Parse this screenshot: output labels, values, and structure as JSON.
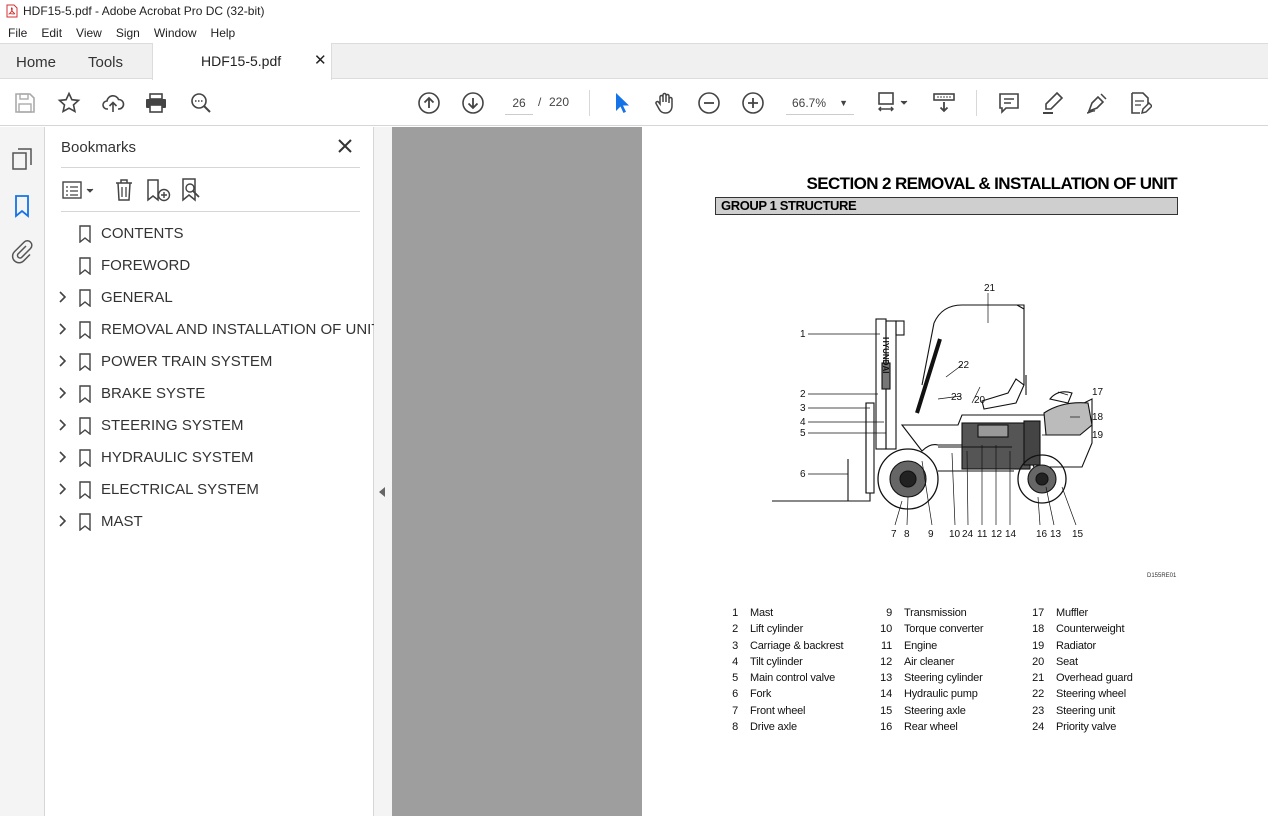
{
  "window": {
    "title": "HDF15-5.pdf - Adobe Acrobat Pro DC (32-bit)"
  },
  "menu": [
    "File",
    "Edit",
    "View",
    "Sign",
    "Window",
    "Help"
  ],
  "tabs": {
    "home": "Home",
    "tools": "Tools",
    "document": "HDF15-5.pdf"
  },
  "toolbar": {
    "page_current": "26",
    "page_separator": "/",
    "page_total": "220",
    "zoom": "66.7%"
  },
  "bookmarks_panel": {
    "title": "Bookmarks",
    "items": [
      {
        "label": "CONTENTS",
        "expandable": false
      },
      {
        "label": "FOREWORD",
        "expandable": false
      },
      {
        "label": "GENERAL",
        "expandable": true
      },
      {
        "label": "REMOVAL AND INSTALLATION OF UNIT",
        "expandable": true
      },
      {
        "label": "POWER TRAIN SYSTEM",
        "expandable": true
      },
      {
        "label": "BRAKE SYSTE",
        "expandable": true
      },
      {
        "label": "STEERING SYSTEM",
        "expandable": true
      },
      {
        "label": "HYDRAULIC SYSTEM",
        "expandable": true
      },
      {
        "label": "ELECTRICAL SYSTEM",
        "expandable": true
      },
      {
        "label": "MAST",
        "expandable": true
      }
    ]
  },
  "document": {
    "section_title": "SECTION 2 REMOVAL & INSTALLATION OF UNIT",
    "group_title": "GROUP 1 STRUCTURE",
    "diagram_code": "D155RE01",
    "diagram_callouts": [
      "1",
      "2",
      "3",
      "4",
      "5",
      "6",
      "7",
      "8",
      "9",
      "10",
      "24",
      "11",
      "12",
      "14",
      "16",
      "13",
      "15",
      "17",
      "18",
      "19",
      "20",
      "21",
      "22",
      "23"
    ],
    "legend": [
      [
        {
          "n": "1",
          "t": "Mast"
        },
        {
          "n": "2",
          "t": "Lift cylinder"
        },
        {
          "n": "3",
          "t": "Carriage & backrest"
        },
        {
          "n": "4",
          "t": "Tilt cylinder"
        },
        {
          "n": "5",
          "t": "Main control valve"
        },
        {
          "n": "6",
          "t": "Fork"
        },
        {
          "n": "7",
          "t": "Front wheel"
        },
        {
          "n": "8",
          "t": "Drive axle"
        }
      ],
      [
        {
          "n": "9",
          "t": "Transmission"
        },
        {
          "n": "10",
          "t": "Torque converter"
        },
        {
          "n": "11",
          "t": "Engine"
        },
        {
          "n": "12",
          "t": "Air cleaner"
        },
        {
          "n": "13",
          "t": "Steering cylinder"
        },
        {
          "n": "14",
          "t": "Hydraulic pump"
        },
        {
          "n": "15",
          "t": "Steering axle"
        },
        {
          "n": "16",
          "t": "Rear wheel"
        }
      ],
      [
        {
          "n": "17",
          "t": "Muffler"
        },
        {
          "n": "18",
          "t": "Counterweight"
        },
        {
          "n": "19",
          "t": "Radiator"
        },
        {
          "n": "20",
          "t": "Seat"
        },
        {
          "n": "21",
          "t": "Overhead guard"
        },
        {
          "n": "22",
          "t": "Steering wheel"
        },
        {
          "n": "23",
          "t": "Steering unit"
        },
        {
          "n": "24",
          "t": "Priority valve"
        }
      ]
    ]
  }
}
